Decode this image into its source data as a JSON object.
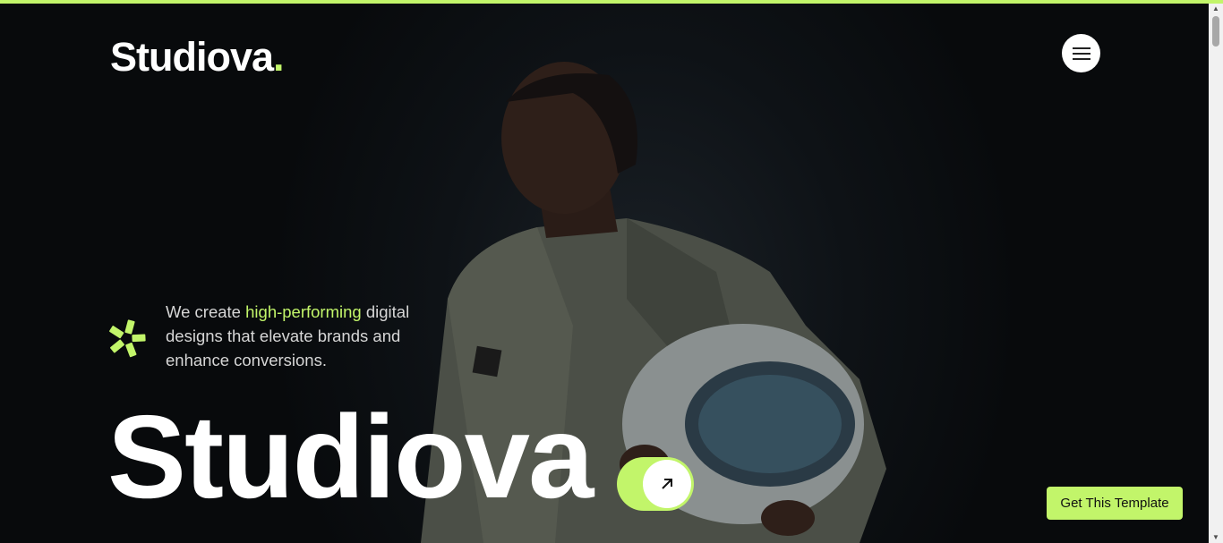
{
  "brand": {
    "name": "Studiova",
    "dot": ".",
    "accent": "#c2f56a"
  },
  "tagline": {
    "before": "We create ",
    "highlight": "high-performing",
    "after": " digital designs that elevate brands and enhance conversions."
  },
  "hero_title": "Studiova",
  "cta_label": "Get This Template",
  "icons": {
    "menu": "hamburger-icon",
    "burst": "sparkle-burst-icon",
    "arrow": "arrow-up-right-icon"
  }
}
